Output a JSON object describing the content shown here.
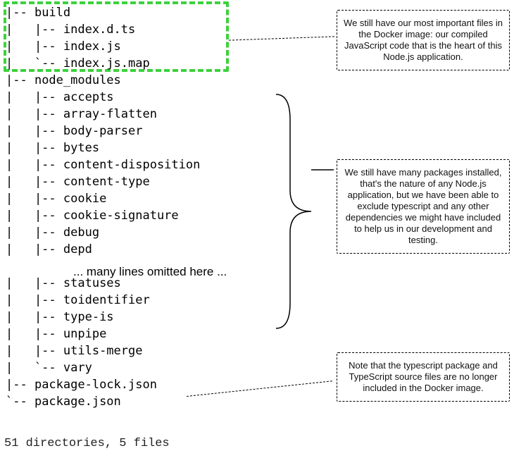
{
  "tree": {
    "build": {
      "name": "build",
      "children": [
        "index.d.ts",
        "index.js",
        "index.js.map"
      ]
    },
    "node_modules": {
      "name": "node_modules",
      "children_before": [
        "accepts",
        "array-flatten",
        "body-parser",
        "bytes",
        "content-disposition",
        "content-type",
        "cookie",
        "cookie-signature",
        "debug",
        "depd"
      ],
      "children_after": [
        "statuses",
        "toidentifier",
        "type-is",
        "unpipe",
        "utils-merge",
        "vary"
      ]
    },
    "root_files": [
      "package-lock.json",
      "package.json"
    ]
  },
  "omitted_text": "... many lines omitted here ...",
  "summary": "51 directories, 5 files",
  "annotations": {
    "ann1": "We still have our most important files in the Docker image: our compiled JavaScript code that is the heart of this Node.js application.",
    "ann2": "We still have many packages installed, that's the nature of any Node.js application, but we have been able to exclude typescript and any other dependencies we might have included to help us in our development and testing.",
    "ann3": "Note that the typescript package and TypeScript source files are no longer included in the Docker image."
  },
  "colors": {
    "highlight": "#3DD13D"
  }
}
